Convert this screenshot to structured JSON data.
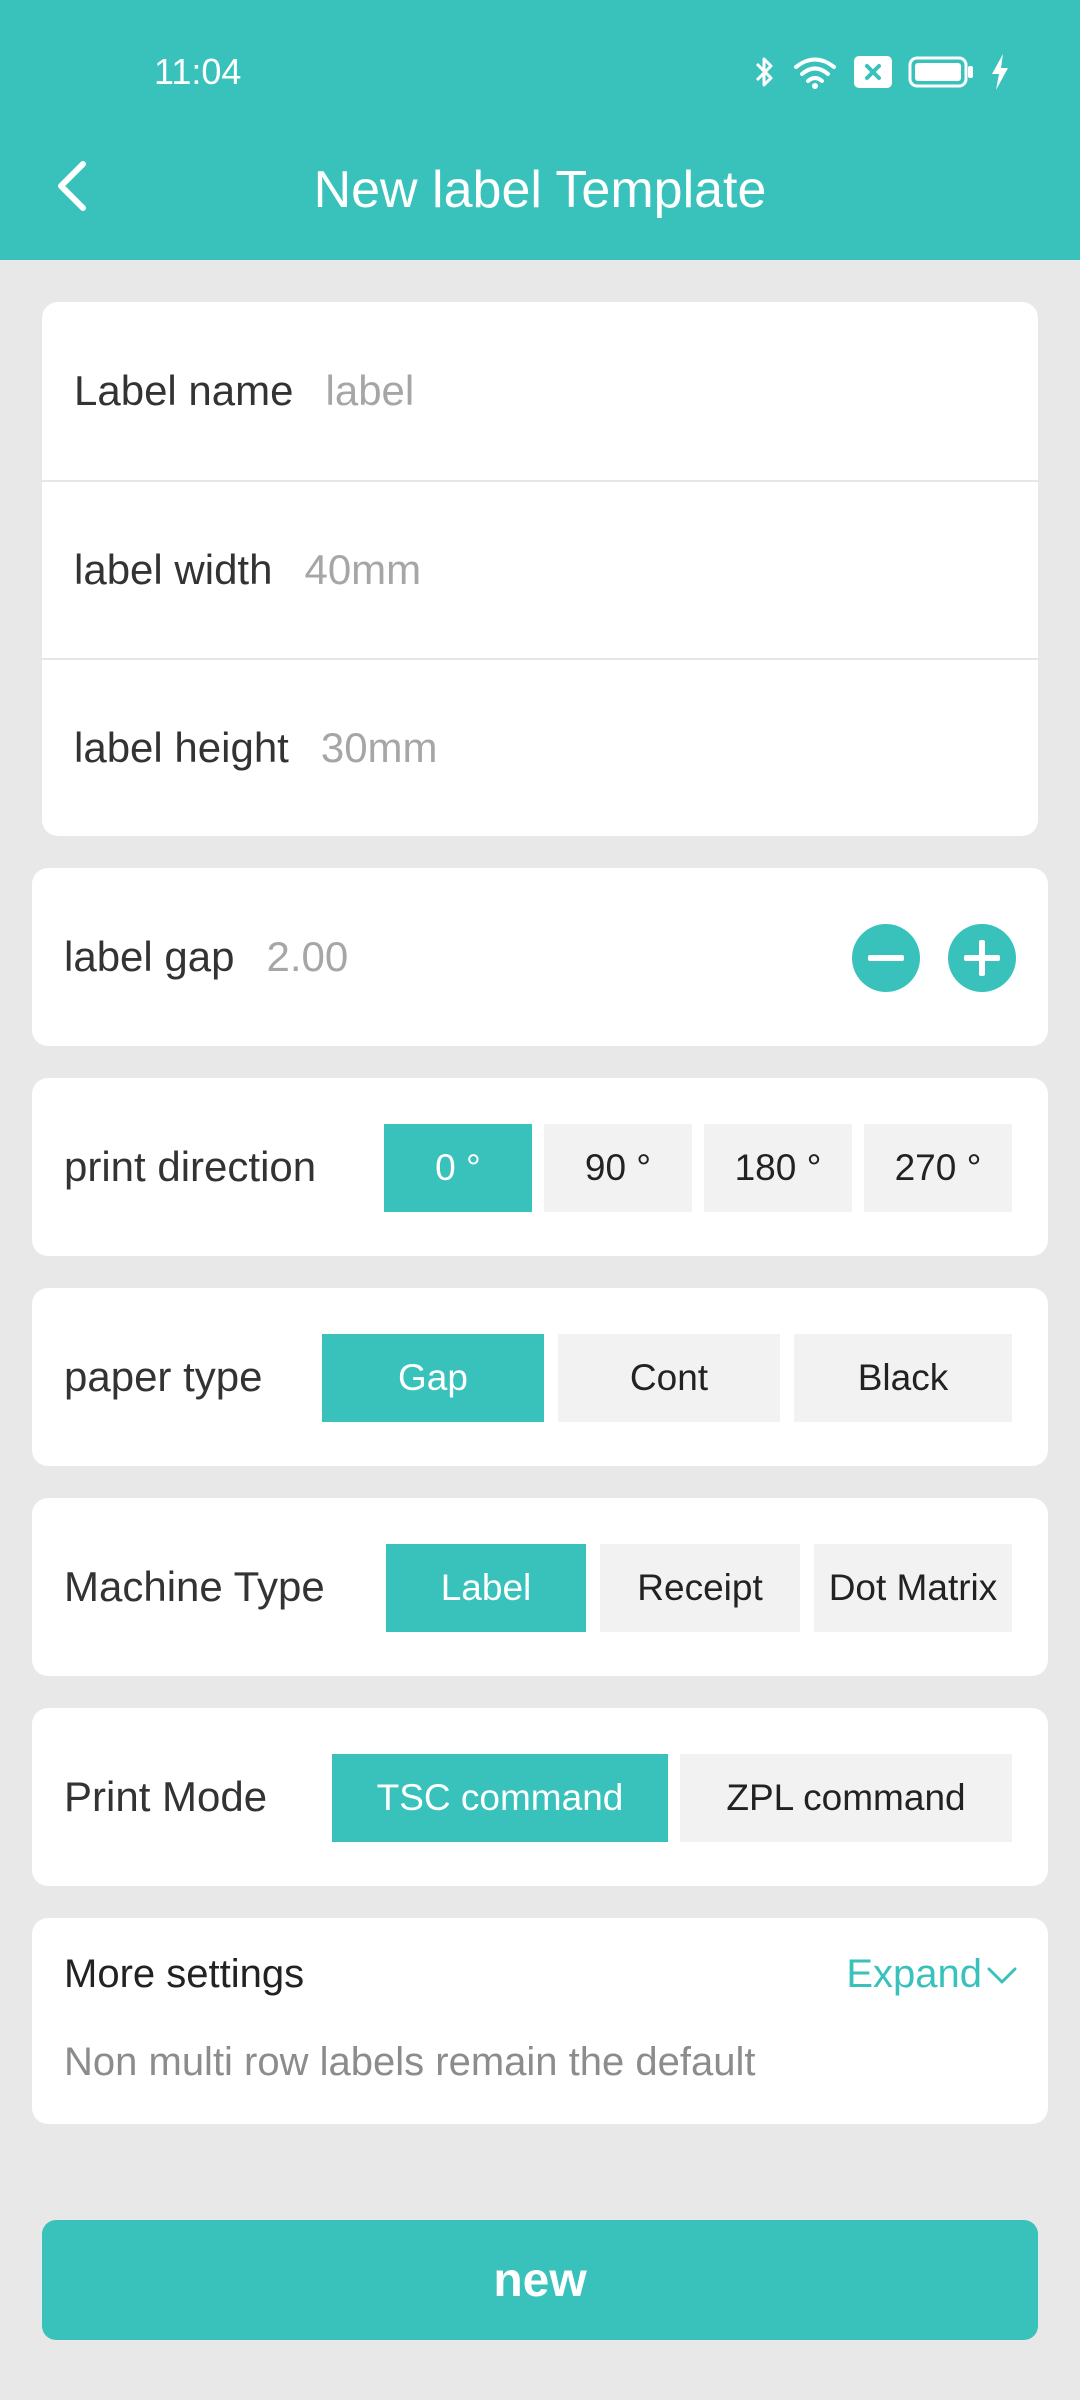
{
  "status_bar": {
    "time": "11:04",
    "icons": [
      "bluetooth-icon",
      "wifi-icon",
      "sim-off-icon",
      "battery-icon",
      "charging-icon"
    ]
  },
  "header": {
    "title": "New label Template",
    "back_icon": "chevron-left-icon"
  },
  "label_info": {
    "name_label": "Label name",
    "name_placeholder": "label",
    "width_label": "label width",
    "width_placeholder": "40mm",
    "height_label": "label height",
    "height_placeholder": "30mm"
  },
  "label_gap": {
    "label": "label gap",
    "value": "2.00"
  },
  "print_direction": {
    "label": "print direction",
    "options": [
      "0 °",
      "90 °",
      "180 °",
      "270 °"
    ],
    "selected": "0 °"
  },
  "paper_type": {
    "label": "paper type",
    "options": [
      "Gap",
      "Cont",
      "Black"
    ],
    "selected": "Gap"
  },
  "machine_type": {
    "label": "Machine Type",
    "options": [
      "Label",
      "Receipt",
      "Dot Matrix"
    ],
    "selected": "Label"
  },
  "print_mode": {
    "label": "Print Mode",
    "options": [
      "TSC command",
      "ZPL command"
    ],
    "selected": "TSC command"
  },
  "more_settings": {
    "title": "More settings",
    "expand_label": "Expand",
    "description": "Non multi row labels remain the default"
  },
  "submit": {
    "label": "new"
  },
  "colors": {
    "accent": "#38c2bb",
    "background": "#e8e8e8",
    "placeholder": "#a6a6a6",
    "option_bg": "#f2f2f2"
  }
}
